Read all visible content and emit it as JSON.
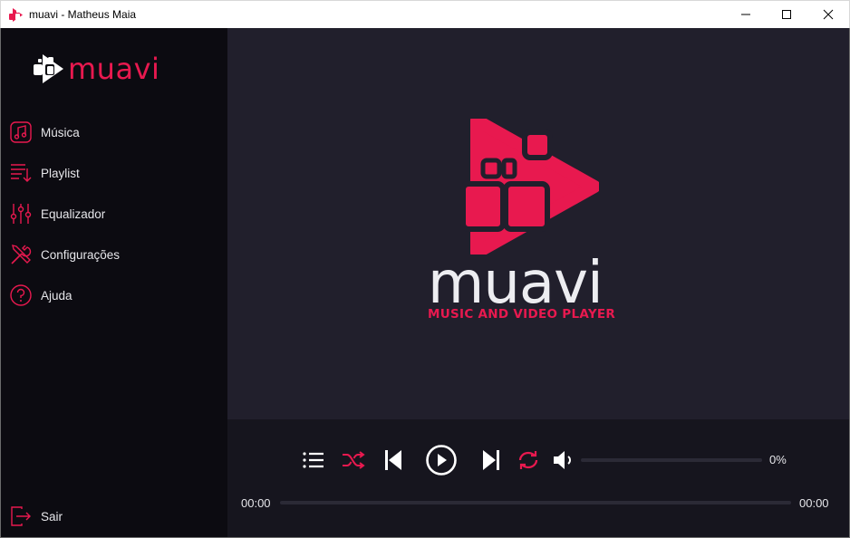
{
  "window": {
    "title": "muavi - Matheus Maia",
    "controls": [
      "minimize-icon",
      "maximize-icon",
      "close-icon"
    ]
  },
  "brand": {
    "name": "muavi",
    "accent_color": "#e8194f"
  },
  "sidebar": {
    "items": [
      {
        "label": "Música",
        "icon": "music-note-icon"
      },
      {
        "label": "Playlist",
        "icon": "playlist-icon"
      },
      {
        "label": "Equalizador",
        "icon": "equalizer-icon"
      },
      {
        "label": "Configurações",
        "icon": "settings-tools-icon"
      },
      {
        "label": "Ajuda",
        "icon": "help-icon"
      }
    ],
    "exit": {
      "label": "Sair",
      "icon": "exit-icon"
    }
  },
  "main": {
    "logo_word": "muavi",
    "logo_tagline": "MUSIC AND VIDEO PLAYER"
  },
  "player": {
    "controls": [
      "list-icon",
      "shuffle-icon",
      "previous-icon",
      "play-icon",
      "next-icon",
      "repeat-icon",
      "volume-icon"
    ],
    "volume_percent": "0%",
    "volume_level": 0,
    "time_current": "00:00",
    "time_total": "00:00",
    "progress": 0
  }
}
